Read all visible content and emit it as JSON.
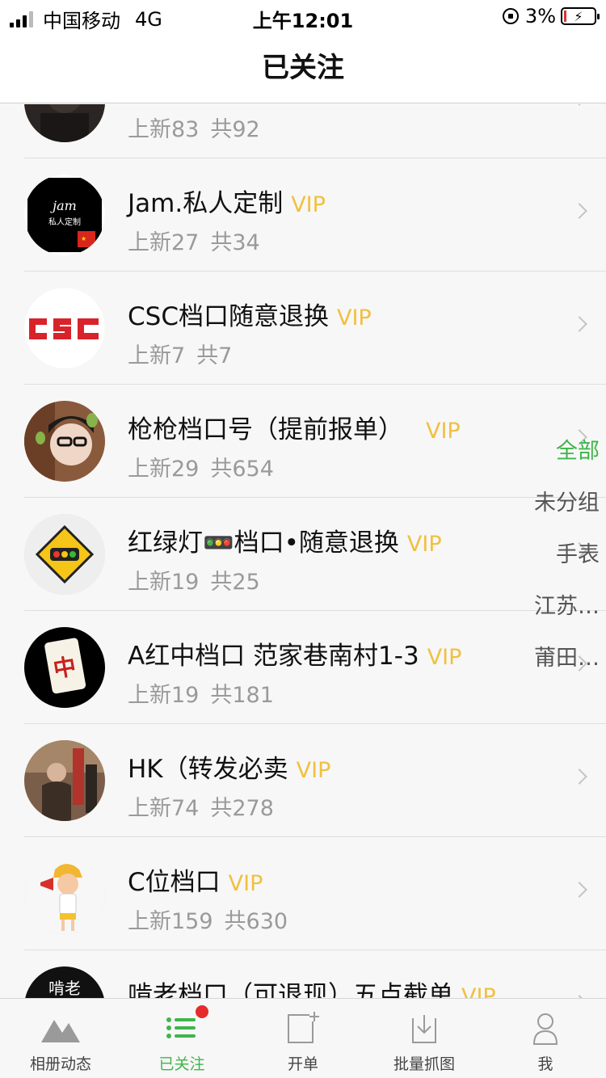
{
  "status_bar": {
    "carrier": "中国移动",
    "network": "4G",
    "time": "上午12:01",
    "battery_percent": "3%"
  },
  "nav": {
    "title": "已关注"
  },
  "list": [
    {
      "name": "",
      "vip": "",
      "new": "上新83",
      "total": "共92",
      "avatar": "person-dark"
    },
    {
      "name": "Jam.私人定制",
      "vip": "VIP",
      "new": "上新27",
      "total": "共34",
      "avatar": "jam-logo"
    },
    {
      "name": "CSC档口随意退换",
      "vip": "VIP",
      "new": "上新7",
      "total": "共7",
      "avatar": "csc-logo"
    },
    {
      "name": "枪枪档口号（提前报单）",
      "vip": "VIP",
      "new": "上新29",
      "total": "共654",
      "avatar": "girl-portrait"
    },
    {
      "name": "红绿灯🚥档口•随意退换",
      "vip": "VIP",
      "new": "上新19",
      "total": "共25",
      "avatar": "traffic-sign"
    },
    {
      "name": "A红中档口 范家巷南村1-3",
      "vip": "VIP",
      "new": "上新19",
      "total": "共181",
      "avatar": "mahjong-tile"
    },
    {
      "name": "HK（转发必卖",
      "vip": "VIP",
      "new": "上新74",
      "total": "共278",
      "avatar": "street-photo"
    },
    {
      "name": "C位档口",
      "vip": "VIP",
      "new": "上新159",
      "total": "共630",
      "avatar": "cartoon-boy"
    },
    {
      "name": "啃老档口（可退现）五点截单",
      "vip": "VIP",
      "new": "",
      "total": "",
      "avatar": "dark-logo"
    }
  ],
  "groups": [
    {
      "label": "全部",
      "active": true
    },
    {
      "label": "未分组",
      "active": false
    },
    {
      "label": "手表",
      "active": false
    },
    {
      "label": "江苏…",
      "active": false
    },
    {
      "label": "莆田…",
      "active": false
    }
  ],
  "tab_bar": [
    {
      "label": "相册动态",
      "icon": "mountain-icon",
      "active": false
    },
    {
      "label": "已关注",
      "icon": "list-icon",
      "active": true,
      "badge": true
    },
    {
      "label": "开单",
      "icon": "new-order-icon",
      "active": false
    },
    {
      "label": "批量抓图",
      "icon": "download-icon",
      "active": false
    },
    {
      "label": "我",
      "icon": "person-icon",
      "active": false
    }
  ],
  "colors": {
    "accent_green": "#3fb54b",
    "vip_gold": "#f0c040",
    "badge_red": "#e52b2b"
  }
}
